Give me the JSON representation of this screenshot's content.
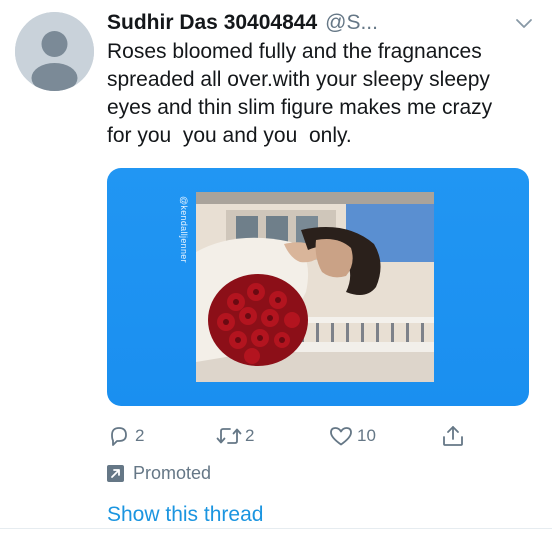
{
  "tweet": {
    "author_name": "Sudhir Das 30404844",
    "author_handle": "@S...",
    "text": "Roses bloomed fully and the fragnances\nspreaded all over.with your sleepy sleepy\neyes and thin slim figure makes me crazy\nfor you  you and you  only.",
    "media": {
      "watermark": "@kendalljenner"
    },
    "actions": {
      "reply_count": "2",
      "retweet_count": "2",
      "like_count": "10"
    },
    "promoted_label": "Promoted",
    "show_thread_label": "Show this thread"
  },
  "icons": {
    "avatar": "default-avatar-icon",
    "menu": "chevron-down-icon",
    "reply": "reply-icon",
    "retweet": "retweet-icon",
    "like": "heart-icon",
    "share": "share-icon",
    "promoted": "promoted-arrow-icon"
  },
  "colors": {
    "text_primary": "#14171a",
    "text_secondary": "#657786",
    "link": "#1b95e0",
    "media_background": "#2196f3"
  }
}
